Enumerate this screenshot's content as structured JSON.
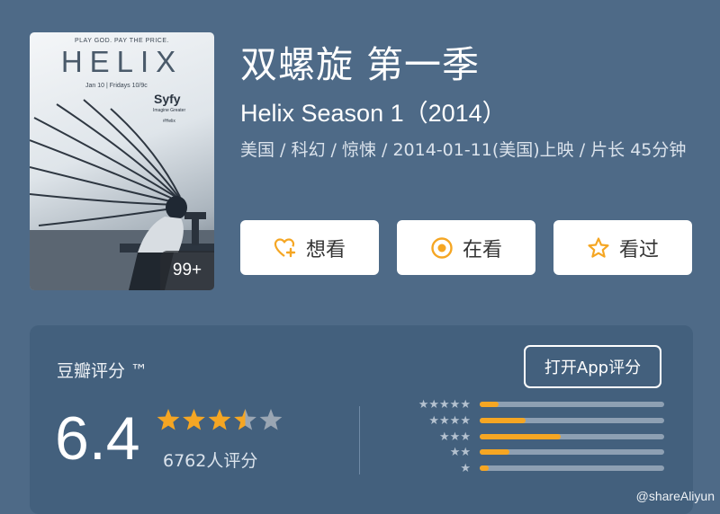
{
  "poster": {
    "tagline": "PLAY GOD. PAY THE PRICE.",
    "title": "HELIX",
    "air_info": "Jan 10 | Fridays 10/9c",
    "network": "Syfy",
    "network_sub": "Imagine Greater",
    "hashtag": "#Helix",
    "badge": "99+"
  },
  "movie": {
    "title_cn": "双螺旋 第一季",
    "title_en": "Helix Season 1（2014）",
    "meta": "美国 / 科幻 / 惊悚 / 2014-01-11(美国)上映 / 片长 45分钟"
  },
  "actions": [
    {
      "label": "想看",
      "icon": "heart-plus-icon"
    },
    {
      "label": "在看",
      "icon": "target-icon"
    },
    {
      "label": "看过",
      "icon": "star-outline-icon"
    }
  ],
  "rating": {
    "label": "豆瓣评分 ™",
    "app_button": "打开App评分",
    "score": "6.4",
    "stars_value": 3.5,
    "stars_max": 5,
    "count_text": "6762人评分",
    "distribution": [
      {
        "stars": 5,
        "stars_text": "★★★★★",
        "fraction": 0.1
      },
      {
        "stars": 4,
        "stars_text": "★★★★",
        "fraction": 0.25
      },
      {
        "stars": 3,
        "stars_text": "★★★",
        "fraction": 0.44
      },
      {
        "stars": 2,
        "stars_text": "★★",
        "fraction": 0.16
      },
      {
        "stars": 1,
        "stars_text": "★",
        "fraction": 0.05
      }
    ]
  },
  "colors": {
    "background": "#4e6a87",
    "card": "#43607d",
    "accent": "#f5a623",
    "star_empty": "#9aa6b3"
  },
  "watermark": "@shareAliyun"
}
